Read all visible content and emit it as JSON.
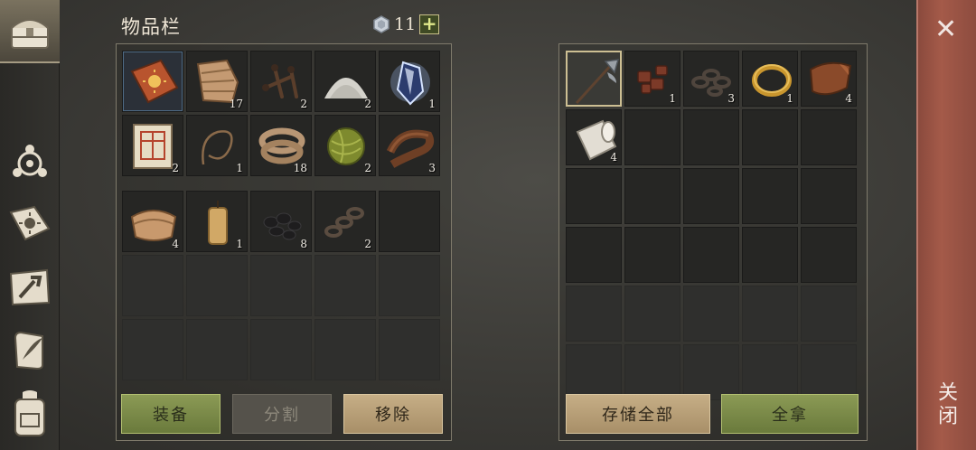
{
  "inventory": {
    "title": "物品栏",
    "currency": {
      "icon": "gem-icon",
      "value": "11"
    },
    "add_label": "+",
    "rows": [
      [
        {
          "name": "recipe-book",
          "qty": ""
        },
        {
          "name": "fabric",
          "qty": "17"
        },
        {
          "name": "nails",
          "qty": "2"
        },
        {
          "name": "powder-pile",
          "qty": "2"
        },
        {
          "name": "crystal",
          "qty": "1"
        }
      ],
      [
        {
          "name": "scroll",
          "qty": "2"
        },
        {
          "name": "string",
          "qty": "1"
        },
        {
          "name": "rope",
          "qty": "18"
        },
        {
          "name": "yarn-ball",
          "qty": "2"
        },
        {
          "name": "leather-strip",
          "qty": "3"
        }
      ],
      [
        {
          "name": "cloth-bundle",
          "qty": "4"
        },
        {
          "name": "candle",
          "qty": "1"
        },
        {
          "name": "coal",
          "qty": "8"
        },
        {
          "name": "chain",
          "qty": "2"
        },
        {
          "name": "",
          "qty": ""
        }
      ]
    ],
    "buttons": {
      "equip": "装备",
      "split": "分割",
      "remove": "移除"
    }
  },
  "storage": {
    "rows": [
      [
        {
          "name": "halberd",
          "qty": ""
        },
        {
          "name": "leather-scraps",
          "qty": "1"
        },
        {
          "name": "chain",
          "qty": "3"
        },
        {
          "name": "gold-ring",
          "qty": "1"
        },
        {
          "name": "leather",
          "qty": "4"
        }
      ],
      [
        {
          "name": "cloth-roll",
          "qty": "4"
        }
      ]
    ],
    "buttons": {
      "store_all": "存储全部",
      "take_all": "全拿"
    }
  },
  "close": {
    "icon": "close-icon",
    "label": "关闭"
  },
  "sidebar": [
    "chest-icon",
    "trinket-icon",
    "sun-book-icon",
    "crafting-icon",
    "quill-scroll-icon",
    "backpack-icon"
  ]
}
